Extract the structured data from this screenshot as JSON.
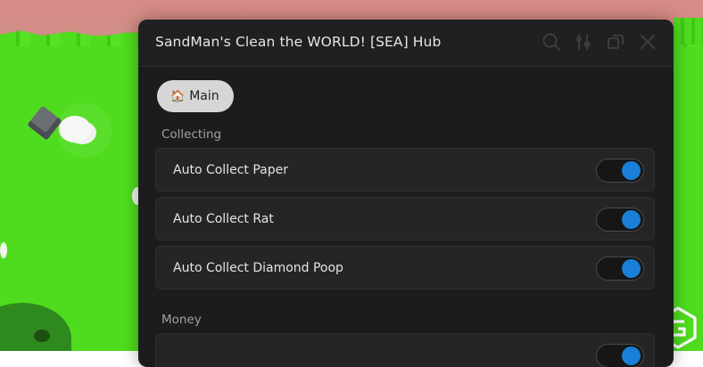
{
  "window": {
    "title": "SandMan's Clean the WORLD! [SEA] Hub",
    "icons": [
      "search-icon",
      "settings-sliders-icon",
      "copy-icon",
      "close-icon"
    ]
  },
  "tabs": [
    {
      "emoji": "🏠",
      "label": "Main",
      "selected": true
    }
  ],
  "sections": [
    {
      "label": "Collecting",
      "items": [
        {
          "label": "Auto Collect Paper",
          "toggled": true
        },
        {
          "label": "Auto Collect Rat",
          "toggled": true
        },
        {
          "label": "Auto Collect Diamond Poop",
          "toggled": true
        }
      ]
    },
    {
      "label": "Money",
      "items": [
        {
          "label": "",
          "toggled": true
        }
      ]
    }
  ],
  "colors": {
    "window_bg": "#1c1c1e",
    "row_bg": "#252527",
    "toggle_on": "#1a7fd6",
    "tab_bg": "#d6d6d6",
    "grass": "#4fdc1e"
  }
}
